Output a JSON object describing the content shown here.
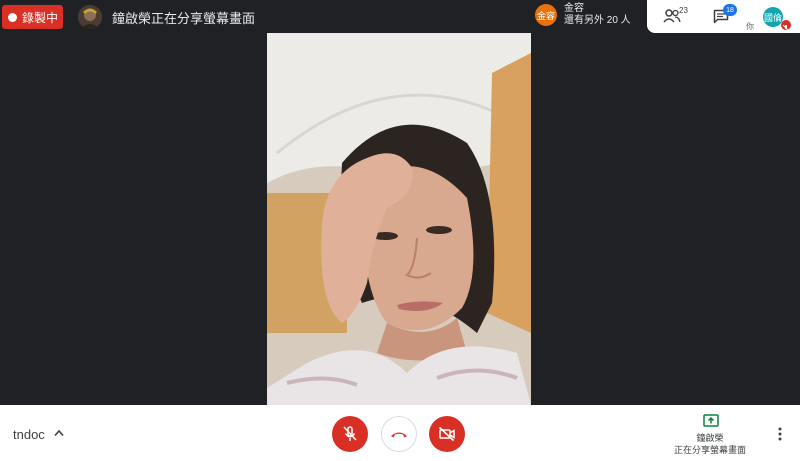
{
  "topbar": {
    "recording_label": "錄製中",
    "presenter_title": "鐘啟榮正在分享螢幕畫面",
    "more_people": {
      "avatar_text": "金容",
      "name": "金容",
      "extra": "還有另外 20 人"
    }
  },
  "topright": {
    "people_count": "23",
    "chat_count": "18",
    "self_avatar_text": "國倫",
    "self_label": "你"
  },
  "bottombar": {
    "meeting_code": "tndoc",
    "presenting_name": "鐘啟榮",
    "presenting_status": "正在分享螢幕畫面"
  },
  "colors": {
    "background": "#202124",
    "recording_red": "#d93025",
    "chat_badge_blue": "#1a73e8",
    "self_avatar_teal": "#12a4af",
    "mini_avatar_orange": "#e8710a"
  },
  "icons": [
    "record-dot-icon",
    "people-icon",
    "chat-icon",
    "mic-off-icon",
    "hangup-icon",
    "camera-off-icon",
    "present-screen-icon",
    "more-vert-icon",
    "chevron-up-icon"
  ]
}
